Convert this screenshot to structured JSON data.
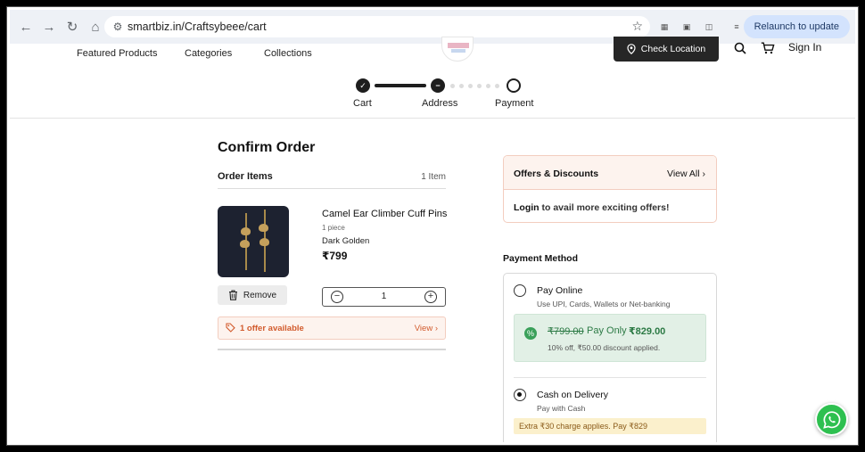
{
  "browser": {
    "url": "smartbiz.in/Craftsybeee/cart",
    "relaunch_label": "Relaunch to update"
  },
  "header": {
    "nav": [
      "Featured Products",
      "Categories",
      "Collections"
    ],
    "check_location": "Check Location",
    "sign_in": "Sign In"
  },
  "stepper": {
    "steps": [
      {
        "label": "Cart",
        "state": "done"
      },
      {
        "label": "Address",
        "state": "current"
      },
      {
        "label": "Payment",
        "state": "todo"
      }
    ]
  },
  "order": {
    "title": "Confirm Order",
    "items_heading": "Order Items",
    "items_count": "1 Item",
    "product": {
      "name": "Camel Ear Climber Cuff Pins",
      "quantity_text": "1 piece",
      "variant": "Dark Golden",
      "price": "₹799",
      "remove_label": "Remove",
      "qty_value": "1"
    },
    "offer": {
      "text": "1 offer available",
      "view_label": "View"
    }
  },
  "offers_card": {
    "title": "Offers & Discounts",
    "view_all": "View All",
    "login_bold": "Login",
    "login_rest": " to avail more exciting offers!"
  },
  "payment": {
    "title": "Payment Method",
    "online": {
      "label": "Pay Online",
      "sub": "Use UPI, Cards, Wallets or Net-banking",
      "old_price": "₹799.00",
      "pay_only": "Pay Only",
      "new_price": "₹829.00",
      "discount_note": "10% off, ₹50.00 discount applied."
    },
    "cod": {
      "label": "Cash on Delivery",
      "sub": "Pay with Cash",
      "note": "Extra ₹30 charge applies. Pay ₹829"
    }
  },
  "colors": {
    "accent_orange": "#d25b2d",
    "success_green": "#2c7a45",
    "dark": "#1e1e1e"
  }
}
